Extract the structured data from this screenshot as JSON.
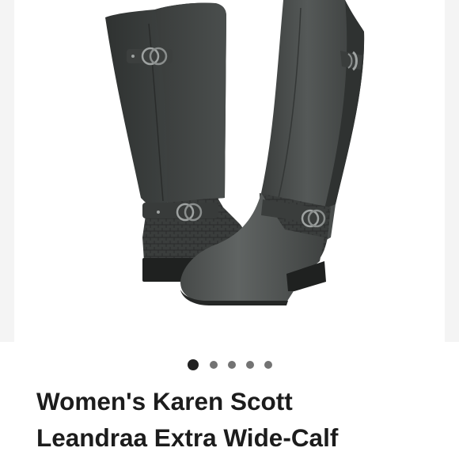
{
  "product": {
    "title_line_1": "Women's Karen Scott",
    "title_line_2": "Leandraa Extra Wide-Calf"
  },
  "image": {
    "icon": "tall-riding-boots-photo"
  },
  "carousel": {
    "total_images": 5,
    "current_index": 1
  },
  "colors": {
    "dot_active": "#202020",
    "dot_inactive": "#737373",
    "title_text": "#1c1c1c"
  }
}
